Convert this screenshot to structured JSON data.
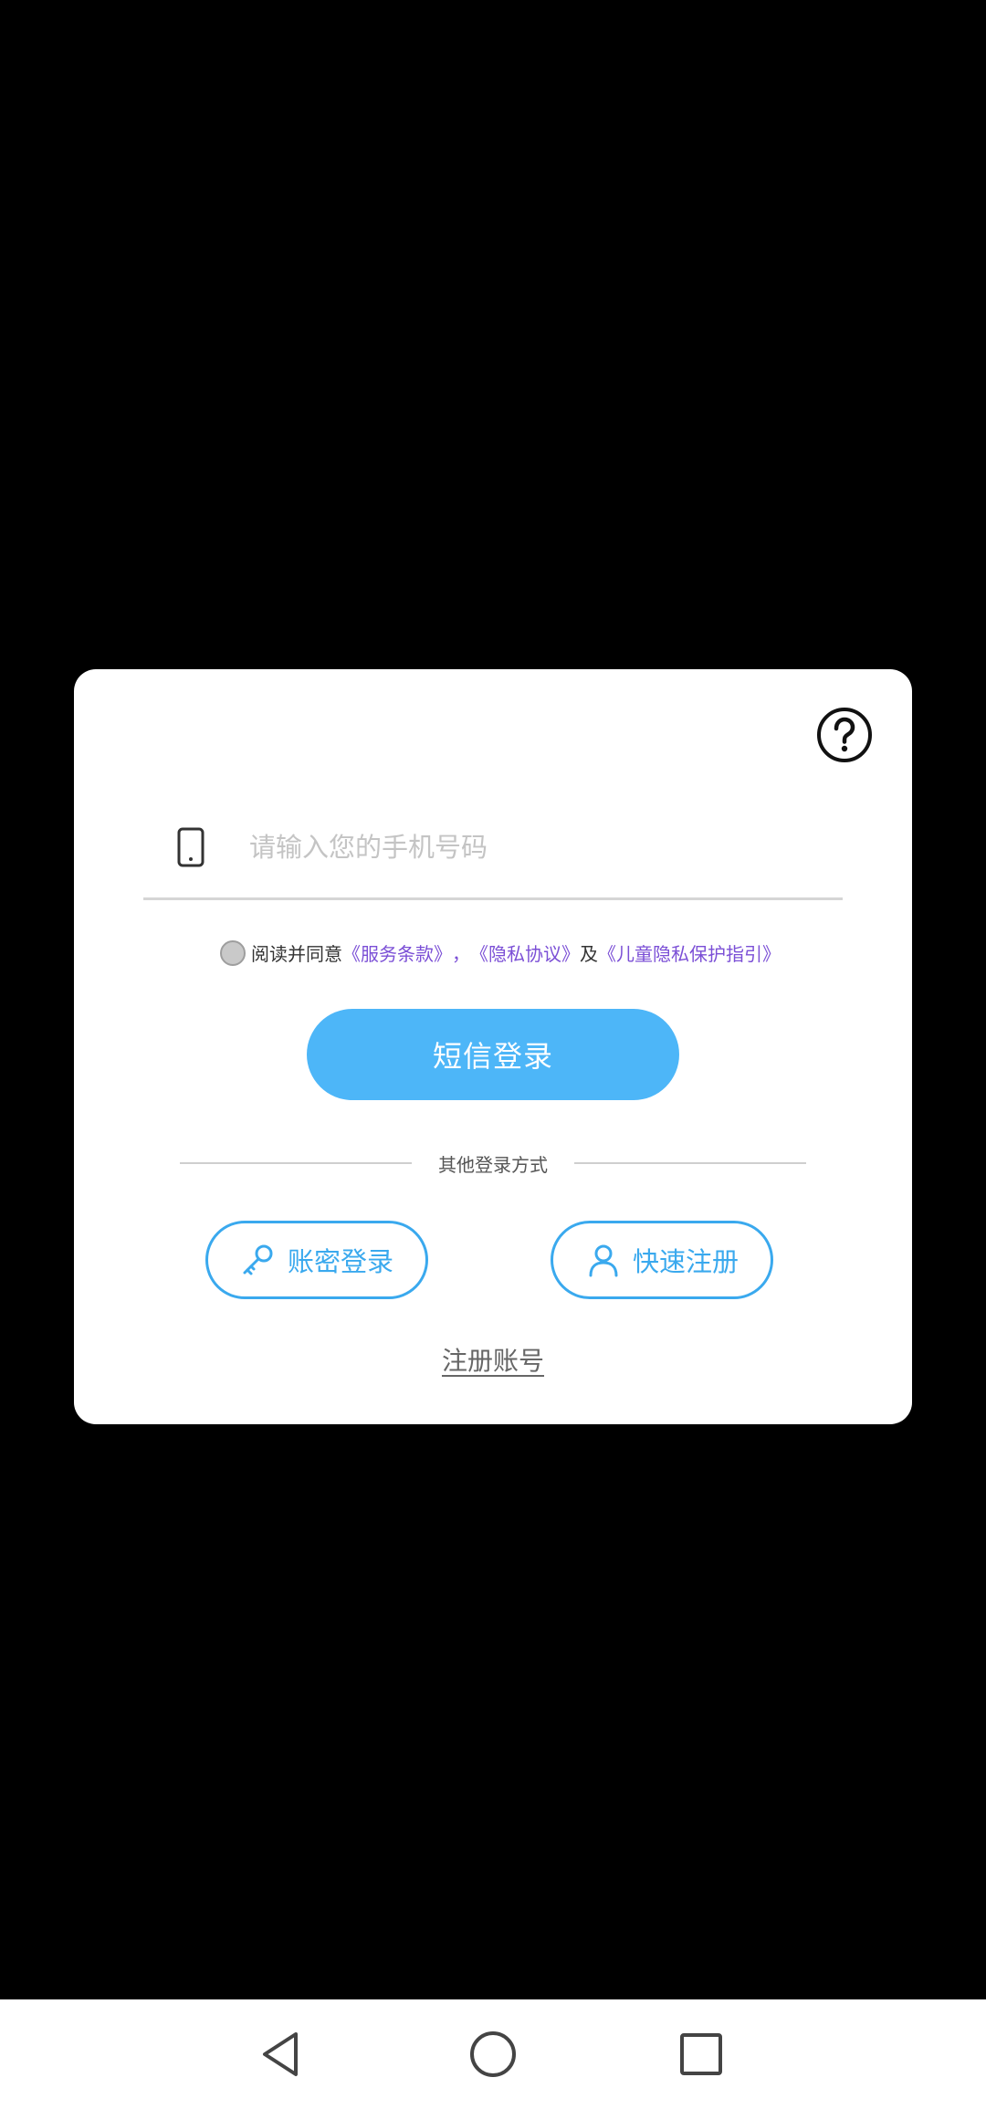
{
  "dialog": {
    "phone_placeholder": "请输入您的手机号码",
    "agreement": {
      "prefix": "阅读并同意",
      "terms": "《服务条款》",
      "comma": "，",
      "privacy": "《隐私协议》",
      "and": "及",
      "child_privacy": "《儿童隐私保护指引》",
      "checked": false
    },
    "sms_login_label": "短信登录",
    "other_methods_label": "其他登录方式",
    "account_login_label": "账密登录",
    "quick_register_label": "快速注册",
    "register_account_label": "注册账号",
    "help_icon": "question-circle-icon"
  },
  "colors": {
    "primary": "#4db6f8",
    "outline_blue": "#3aa9ee",
    "link_purple": "#7b4fd6",
    "background": "#000000"
  },
  "nav": {
    "back_icon": "back-triangle-icon",
    "home_icon": "home-circle-icon",
    "recent_icon": "recent-square-icon"
  }
}
